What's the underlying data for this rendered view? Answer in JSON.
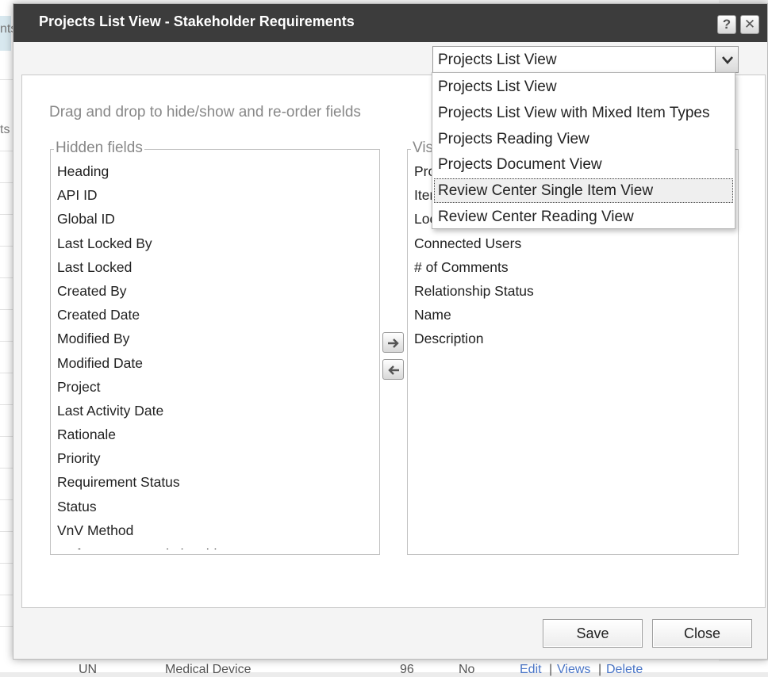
{
  "background": {
    "left_text_top": "nts",
    "left_text_mid": "ts",
    "bottom_row": {
      "col1": "UN",
      "col2": "Medical Device",
      "col3": "96",
      "col4": "No",
      "link_edit": "Edit",
      "sep1": "|",
      "link_views": "Views",
      "sep2": "|",
      "link_delete": "Delete"
    }
  },
  "dialog": {
    "title": "Projects List View - Stakeholder Requirements",
    "help_label": "?",
    "close_label": "✕",
    "view_select": {
      "selected": "Projects List View",
      "options": [
        "Projects List View",
        "Projects List View with Mixed Item Types",
        "Projects Reading View",
        "Projects Document View",
        "Review Center Single Item View",
        "Review Center Reading View"
      ],
      "highlighted_index": 4
    },
    "instructions": "Drag and drop to hide/show and re-order fields",
    "hidden_fields": {
      "legend": "Hidden fields",
      "items": [
        "Heading",
        "API ID",
        "Global ID",
        "Last Locked By",
        "Last Locked",
        "Created By",
        "Created Date",
        "Modified By",
        "Modified Date",
        "Project",
        "Last Activity Date",
        "Rationale",
        "Priority",
        "Requirement Status",
        "Status",
        "VnV Method",
        "# of Upstream Relationships"
      ]
    },
    "visible_fields": {
      "legend": "Visible fields",
      "items": [
        "Project",
        "Item ID",
        "Locked",
        "Connected Users",
        "# of Comments",
        "Relationship Status",
        "Name",
        "Description"
      ]
    },
    "footer": {
      "save_label": "Save",
      "close_label": "Close"
    }
  }
}
